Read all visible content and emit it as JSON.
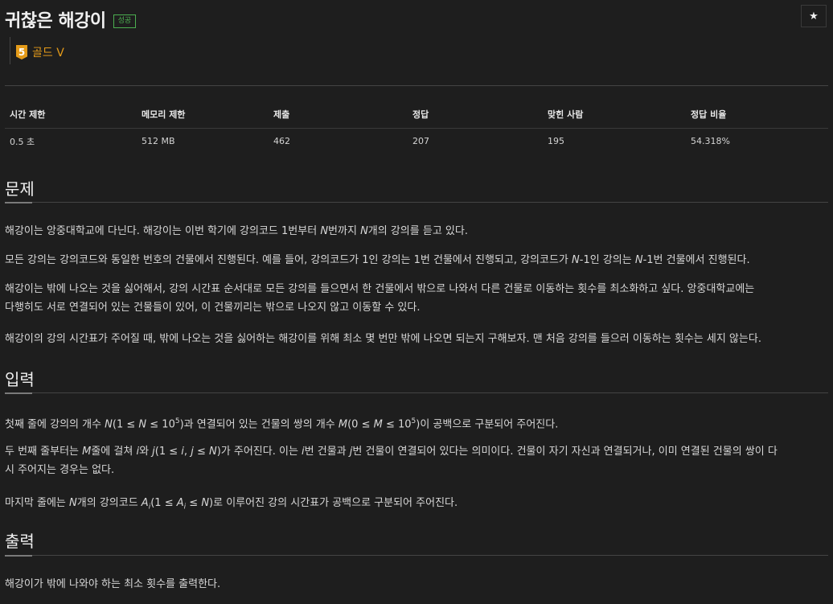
{
  "problem": {
    "title": "귀찮은 해강이",
    "status_badge": "성공",
    "star_icon": "★",
    "tier_number": "5",
    "tier_label": "골드 V"
  },
  "stats": {
    "headers": [
      "시간 제한",
      "메모리 제한",
      "제출",
      "정답",
      "맞힌 사람",
      "정답 비율"
    ],
    "values": [
      "0.5 초",
      "512 MB",
      "462",
      "207",
      "195",
      "54.318%"
    ]
  },
  "sections": {
    "problem_title": "문제",
    "input_title": "입력",
    "output_title": "출력"
  },
  "description": {
    "p1": "해강이는 앙중대학교에 다닌다. 해강이는 이번 학기에 강의코드 1번부터 N번까지 N개의 강의를 듣고 있다.",
    "p2": "모든 강의는 강의코드와 동일한 번호의 건물에서 진행된다. 예를 들어, 강의코드가 1인 강의는 1번 건물에서 진행되고, 강의코드가 N-1인 강의는 N-1번 건물에서 진행된다.",
    "p3a": "해강이는 밖에 나오는 것을 싫어해서, 강의 시간표 순서대로 모든 강의를 들으면서 한 건물에서 밖으로 나와서 다른 건물로 이동하는 횟수를 최소화하고 싶다. 앙중대학교에는",
    "p3b": "다행히도 서로 연결되어 있는 건물들이 있어, 이 건물끼리는 밖으로 나오지 않고 이동할 수 있다.",
    "p4": "해강이의 강의 시간표가 주어질 때, 밖에 나오는 것을 싫어하는 해강이를 위해 최소 몇 번만 밖에 나오면 되는지 구해보자. 맨 처음 강의를 들으러 이동하는 횟수는 세지 않는다."
  },
  "input": {
    "p1": "첫째 줄에 강의의 개수 N(1 ≤ N ≤ 10⁵)과 연결되어 있는 건물의 쌍의 개수 M(0 ≤ M ≤ 10⁵)이 공백으로 구분되어 주어진다.",
    "p2a": "두 번째 줄부터는 M줄에 걸쳐 i와 j(1 ≤ i, j ≤ N)가 주어진다. 이는 i번 건물과 j번 건물이 연결되어 있다는 의미이다. 건물이 자기 자신과 연결되거나, 이미 연결된 건물의 쌍이 다",
    "p2b": "시 주어지는 경우는 없다.",
    "p3": "마지막 줄에는 N개의 강의코드 Aᵢ(1 ≤ Aᵢ ≤ N)로 이루어진 강의 시간표가 공백으로 구분되어 주어진다."
  },
  "output": {
    "p1": "해강이가 밖에 나와야 하는 최소 횟수를 출력한다."
  }
}
